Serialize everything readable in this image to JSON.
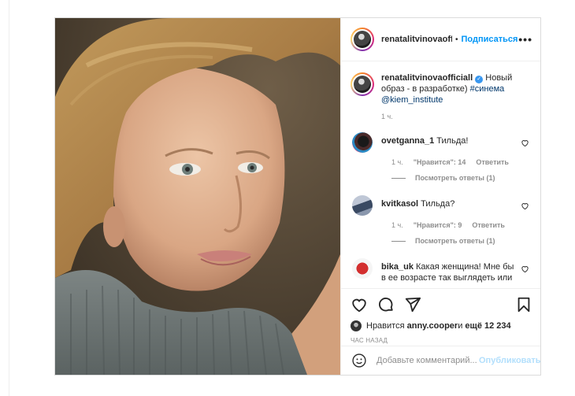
{
  "post": {
    "header": {
      "username": "renatalitvinovaofficiall",
      "dot": "•",
      "follow_label": "Подписаться",
      "more": "•••"
    },
    "caption": {
      "username": "renatalitvinovaofficiall",
      "text_before": " Новый образ - в разработке) ",
      "hashtag": "#синема",
      "mention": "@kiem_institute",
      "time": "1 ч."
    },
    "comments": [
      {
        "username": "ovetganna_1",
        "text": " Тильда!",
        "time": "1 ч.",
        "likes": "\"Нравится\": 14",
        "reply": "Ответить",
        "view_replies": "Посмотреть ответы (1)"
      },
      {
        "username": "kvitkasol",
        "text": " Тильда?",
        "time": "1 ч.",
        "likes": "\"Нравится\": 9",
        "reply": "Ответить",
        "view_replies": "Посмотреть ответы (1)"
      },
      {
        "username": "bika_uk",
        "text": " Какая женщина! Мне бы в ее возрасте так выглядеть или"
      }
    ],
    "likes": {
      "prefix": "Нравится ",
      "user": "anny.cooper",
      "middle": " и ",
      "count": "ещё 12 234"
    },
    "time_ago": "ЧАС НАЗАД",
    "add_comment": {
      "placeholder": "Добавьте комментарий...",
      "publish_label": "Опубликовать"
    },
    "colors": {
      "accent": "#0095f6",
      "muted": "#8e8e8e",
      "publish_disabled": "#b2dffc"
    }
  }
}
